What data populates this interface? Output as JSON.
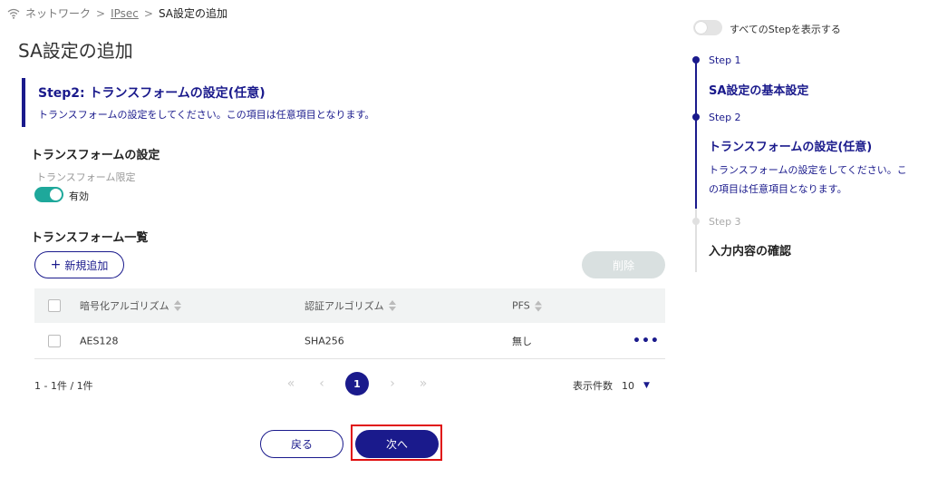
{
  "breadcrumb": {
    "icon": "wifi-icon",
    "items": [
      "ネットワーク",
      "IPsec",
      "SA設定の追加"
    ],
    "separator": ">"
  },
  "page_title": "SA設定の追加",
  "step_header": {
    "title": "Step2: トランスフォームの設定(任意)",
    "description": "トランスフォームの設定をしてください。この項目は任意項目となります。"
  },
  "transform_settings": {
    "title": "トランスフォームの設定",
    "limit_label": "トランスフォーム限定",
    "toggle_on": true,
    "toggle_label": "有効"
  },
  "transform_list": {
    "title": "トランスフォーム一覧",
    "add_button": "新規追加",
    "delete_button": "削除",
    "columns": [
      "暗号化アルゴリズム",
      "認証アルゴリズム",
      "PFS"
    ],
    "rows": [
      {
        "encryption": "AES128",
        "auth": "SHA256",
        "pfs": "無し",
        "more": "•••"
      }
    ],
    "count_text": "1 - 1件 / 1件",
    "pagination": {
      "first": "«",
      "prev": "‹",
      "current": "1",
      "next": "›",
      "last": "»"
    },
    "per_page_label": "表示件数",
    "per_page_value": "10"
  },
  "actions": {
    "back": "戻る",
    "next": "次へ"
  },
  "sidebar": {
    "show_all_label": "すべてのStepを表示する",
    "show_all_on": false,
    "steps": [
      {
        "label": "Step 1",
        "name": "SA設定の基本設定",
        "state": "done"
      },
      {
        "label": "Step 2",
        "name": "トランスフォームの設定(任意)",
        "description": "トランスフォームの設定をしてください。この項目は任意項目となります。",
        "state": "current"
      },
      {
        "label": "Step 3",
        "name": "入力内容の確認",
        "state": "pending"
      }
    ]
  },
  "colors": {
    "primary": "#1a1a8c",
    "toggle_on": "#1ea89b",
    "highlight": "#e01010",
    "disabled": "#d9e0e0"
  }
}
